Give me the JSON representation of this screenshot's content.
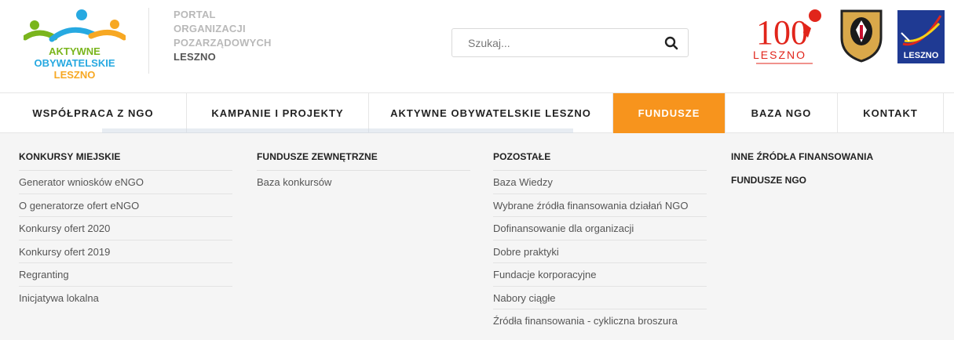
{
  "logo": {
    "line1": "AKTYWNE",
    "line2": "OBYWATELSKIE",
    "line3": "LESZNO",
    "colors": {
      "green": "#7ab51d",
      "blue": "#27a9e1",
      "orange": "#f7a823"
    }
  },
  "portal": {
    "line1": "PORTAL",
    "line2": "ORGANIZACJI",
    "line3": "POZARZĄDOWYCH",
    "line4": "LESZNO"
  },
  "search": {
    "placeholder": "Szukaj...",
    "icon": "magnifier-icon"
  },
  "badges": {
    "leszno100_number": "100",
    "leszno100_text": "LESZNO",
    "city_logo_text": "LESZNO"
  },
  "nav": {
    "items": [
      {
        "label": "WSPÓŁPRACA Z NGO"
      },
      {
        "label": "KAMPANIE I PROJEKTY"
      },
      {
        "label": "AKTYWNE OBYWATELSKIE LESZNO"
      },
      {
        "label": "FUNDUSZE"
      },
      {
        "label": "BAZA NGO"
      },
      {
        "label": "KONTAKT"
      }
    ],
    "active_color": "#f7941d"
  },
  "menu": {
    "col1": {
      "title": "KONKURSY MIEJSKIE",
      "links": [
        "Generator wniosków eNGO",
        "O generatorze ofert eNGO",
        "Konkursy ofert 2020",
        "Konkursy ofert 2019",
        "Regranting",
        "Inicjatywa lokalna"
      ]
    },
    "col2": {
      "title": "FUNDUSZE ZEWNĘTRZNE",
      "links": [
        "Baza konkursów"
      ]
    },
    "col3": {
      "title": "POZOSTAŁE",
      "links": [
        "Baza Wiedzy",
        "Wybrane źródła finansowania działań NGO",
        "Dofinansowanie dla organizacji",
        "Dobre praktyki",
        "Fundacje korporacyjne",
        "Nabory ciągłe",
        "Źródła finansowania - cykliczna broszura"
      ]
    },
    "col4": {
      "title": "INNE ŹRÓDŁA FINANSOWANIA",
      "title2": "FUNDUSZE NGO"
    }
  }
}
